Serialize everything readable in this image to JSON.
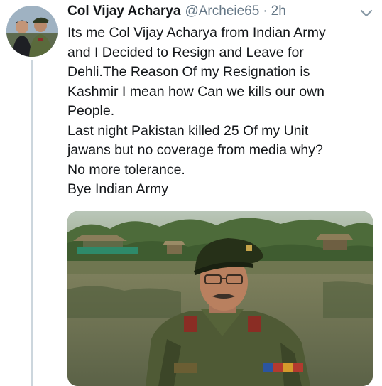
{
  "tweet": {
    "display_name": "Col Vijay Acharya",
    "handle": "@Archeie65",
    "separator": "·",
    "time": "2h",
    "text_lines": [
      "Its me Col Vijay Acharya from Indian Army",
      "and I Decided to Resign and Leave for",
      "Dehli.The Reason Of my Resignation is",
      "Kashmir I mean how Can we kills our own",
      "People.",
      "Last night Pakistan killed 25 Of my Unit",
      "jawans but no coverage from media why?",
      "No more tolerance.",
      "Bye Indian Army"
    ],
    "menu_icon": "chevron-down-icon",
    "media_alt_icon": "photo-soldier-beret"
  },
  "colors": {
    "text": "#14171a",
    "secondary": "#657786",
    "thread_line": "#ccd6dd"
  }
}
